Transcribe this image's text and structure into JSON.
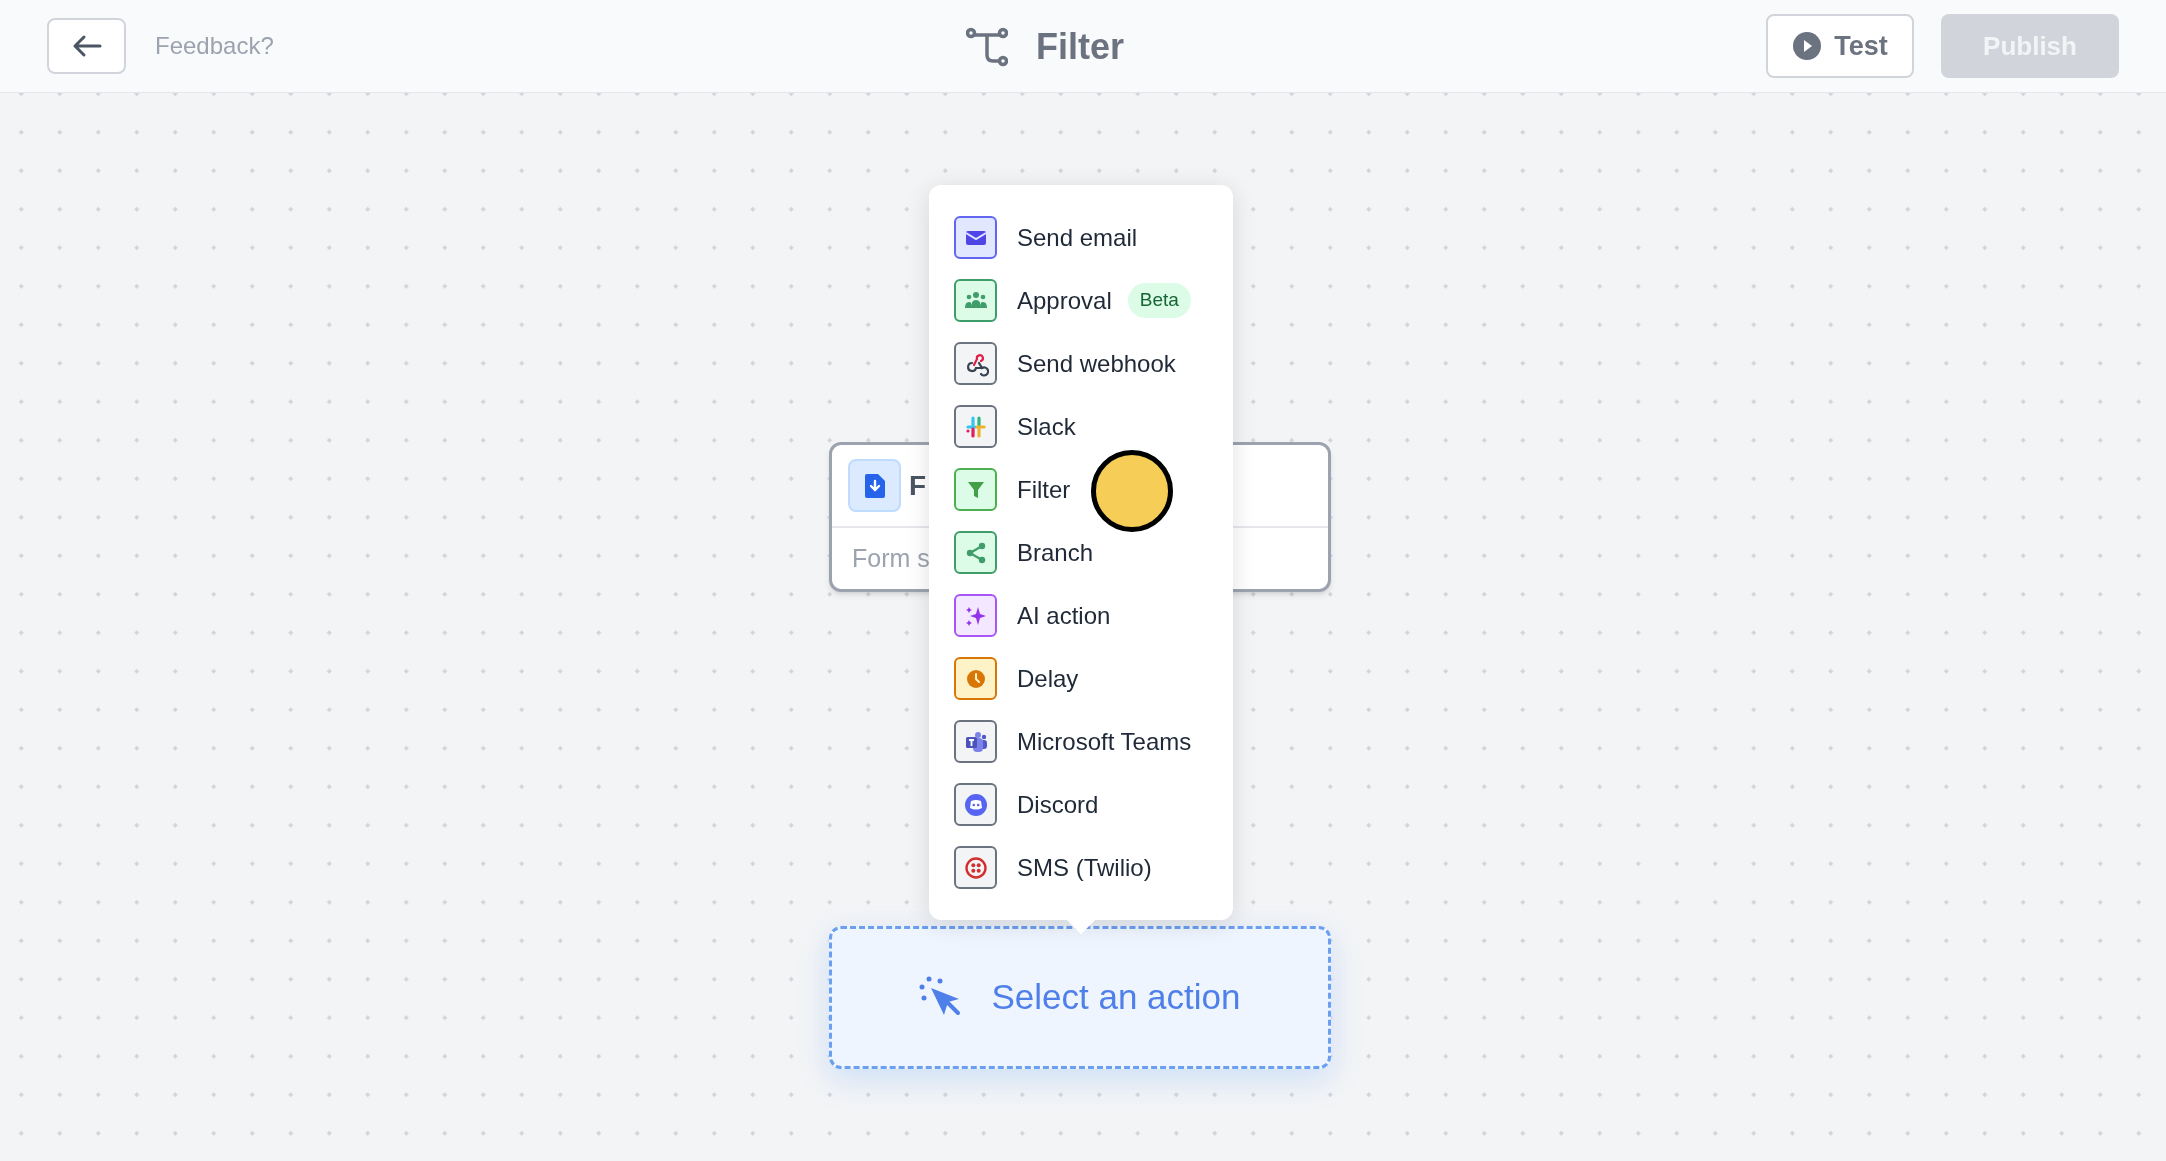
{
  "header": {
    "feedback": "Feedback?",
    "title": "Filter",
    "test_button": "Test",
    "publish_button": {
      "label": "Publish",
      "disabled": true
    }
  },
  "trigger_node": {
    "title": "F",
    "subtitle": "Form s"
  },
  "action_menu": {
    "items": [
      {
        "kind": "email",
        "label": "Send email"
      },
      {
        "kind": "approval",
        "label": "Approval",
        "badge": "Beta"
      },
      {
        "kind": "webhook",
        "label": "Send webhook"
      },
      {
        "kind": "slack",
        "label": "Slack"
      },
      {
        "kind": "filter",
        "label": "Filter"
      },
      {
        "kind": "branch",
        "label": "Branch"
      },
      {
        "kind": "ai",
        "label": "AI action"
      },
      {
        "kind": "delay",
        "label": "Delay"
      },
      {
        "kind": "teams",
        "label": "Microsoft Teams"
      },
      {
        "kind": "discord",
        "label": "Discord"
      },
      {
        "kind": "twilio",
        "label": "SMS (Twilio)"
      }
    ]
  },
  "placeholder_node": {
    "label": "Select an action"
  }
}
